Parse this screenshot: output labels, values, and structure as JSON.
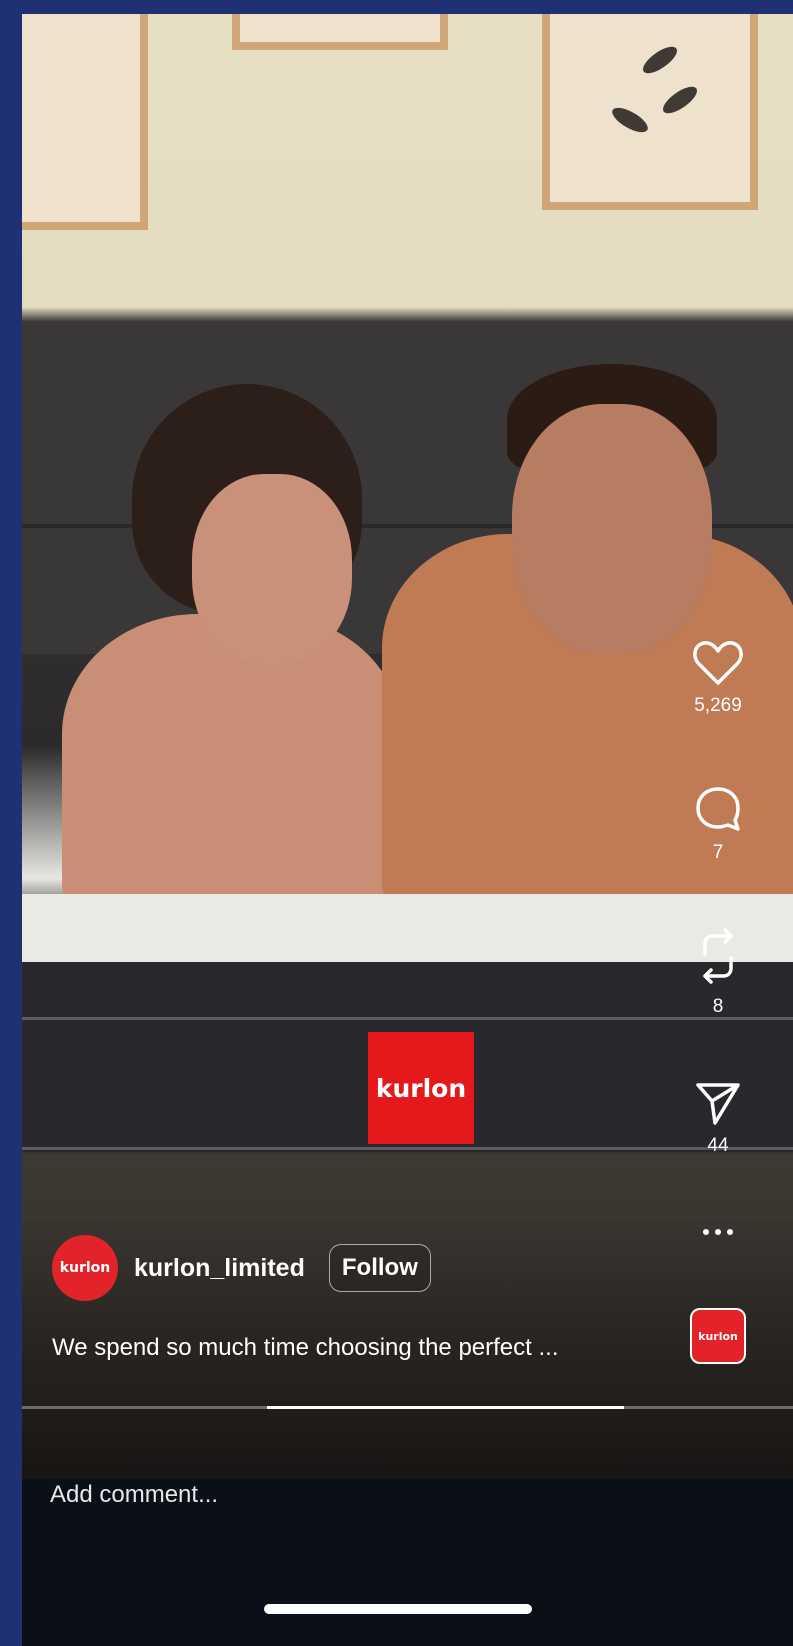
{
  "brand": {
    "tag_text": "kurlon",
    "color": "#e5191c"
  },
  "actions": {
    "like": {
      "icon": "heart-icon",
      "count": "5,269"
    },
    "comment": {
      "icon": "comment-icon",
      "count": "7"
    },
    "repost": {
      "icon": "repost-icon",
      "count": "8"
    },
    "share": {
      "icon": "send-icon",
      "count": "44"
    },
    "more": {
      "icon": "more-icon",
      "label": "..."
    }
  },
  "author": {
    "avatar_text": "kurlon",
    "username": "kurlon_limited",
    "follow_label": "Follow"
  },
  "caption": "We spend so much time choosing the perfect ...",
  "music": {
    "thumb_text": "kurlon"
  },
  "playback": {
    "progress": 0.32
  },
  "comment": {
    "placeholder": "Add comment..."
  },
  "colors": {
    "background": "#1f3173",
    "panel": "#0b0f17"
  }
}
